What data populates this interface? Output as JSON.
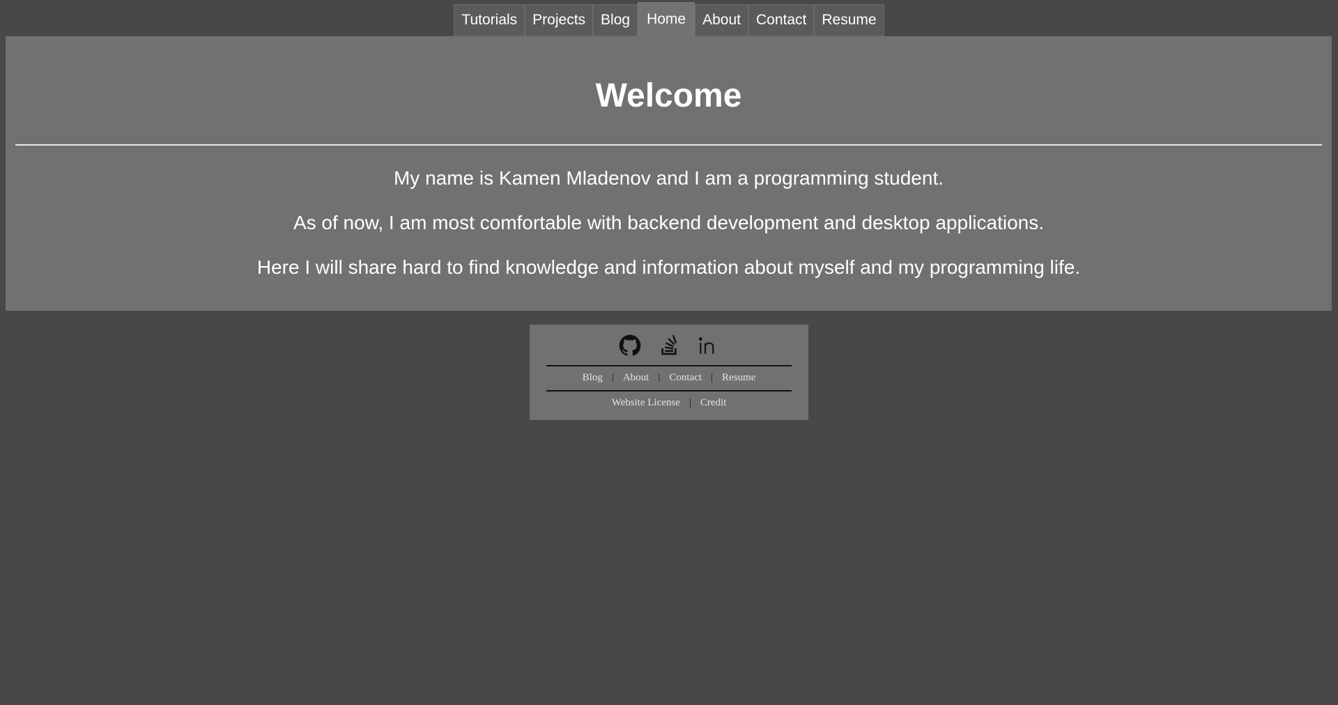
{
  "nav": {
    "tabs": [
      {
        "label": "Tutorials"
      },
      {
        "label": "Projects"
      },
      {
        "label": "Blog"
      },
      {
        "label": "Home",
        "active": true
      },
      {
        "label": "About"
      },
      {
        "label": "Contact"
      },
      {
        "label": "Resume"
      }
    ]
  },
  "main": {
    "title": "Welcome",
    "paragraphs": [
      "My name is Kamen Mladenov and I am a programming student.",
      "As of now, I am most comfortable with backend development and desktop applications.",
      "Here I will share hard to find knowledge and information about myself and my programming life."
    ]
  },
  "footer": {
    "socials": [
      "github-icon",
      "stackoverflow-icon",
      "linkedin-icon"
    ],
    "links_row1": [
      "Blog",
      "About",
      "Contact",
      "Resume"
    ],
    "links_row2": [
      "Website License",
      "Credit"
    ],
    "separator": "|"
  },
  "colors": {
    "background": "#484848",
    "panel": "#717171",
    "tab": "#5b5b5b",
    "active_tab": "#727272"
  }
}
